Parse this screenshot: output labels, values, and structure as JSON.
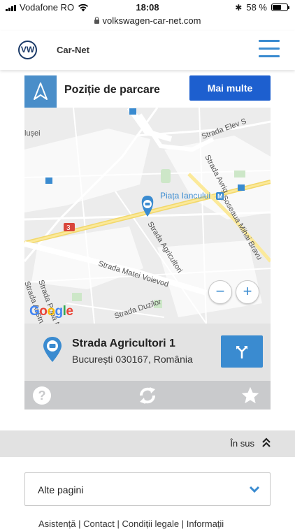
{
  "status_bar": {
    "carrier": "Vodafone RO",
    "time": "18:08",
    "battery": "58 %",
    "battery_level": 0.58
  },
  "browser": {
    "url": "volkswagen-car-net.com"
  },
  "header": {
    "logo_text": "VW",
    "brand": "Car-Net"
  },
  "card": {
    "title": "Poziție de parcare",
    "more_button": "Mai multe",
    "map": {
      "streets": [
        "Strada Elev S",
        "Strada Avrig",
        "Șoseaua Mihai Bravu",
        "Piața Iancului",
        "Strada Agricultori",
        "Strada Matei Voievod",
        "Strada Duzilor",
        "Strada Popa Nicolae",
        "Strada Austrului",
        "lușei"
      ],
      "poi": "Piața Iancului",
      "road_number": "3",
      "attribution": [
        "G",
        "o",
        "o",
        "g",
        "l",
        "e"
      ],
      "attribution_colors": [
        "#4285F4",
        "#EA4335",
        "#FBBC05",
        "#4285F4",
        "#34A853",
        "#EA4335"
      ],
      "zoom_out": "−",
      "zoom_in": "+"
    },
    "address": {
      "street": "Strada Agricultori 1",
      "city": "București 030167, România"
    },
    "actions": [
      "help-icon",
      "refresh-icon",
      "star-icon"
    ]
  },
  "back_to_top": {
    "label": "În sus"
  },
  "other_pages": {
    "label": "Alte pagini"
  },
  "footer": {
    "links_text": "Asistență | Contact | Condiții legale | Informații"
  },
  "colors": {
    "accent": "#3a8bd0",
    "primary_button": "#1d5fcf",
    "address_bg": "#e3e3e3",
    "actions_bg": "#c9cacc"
  }
}
